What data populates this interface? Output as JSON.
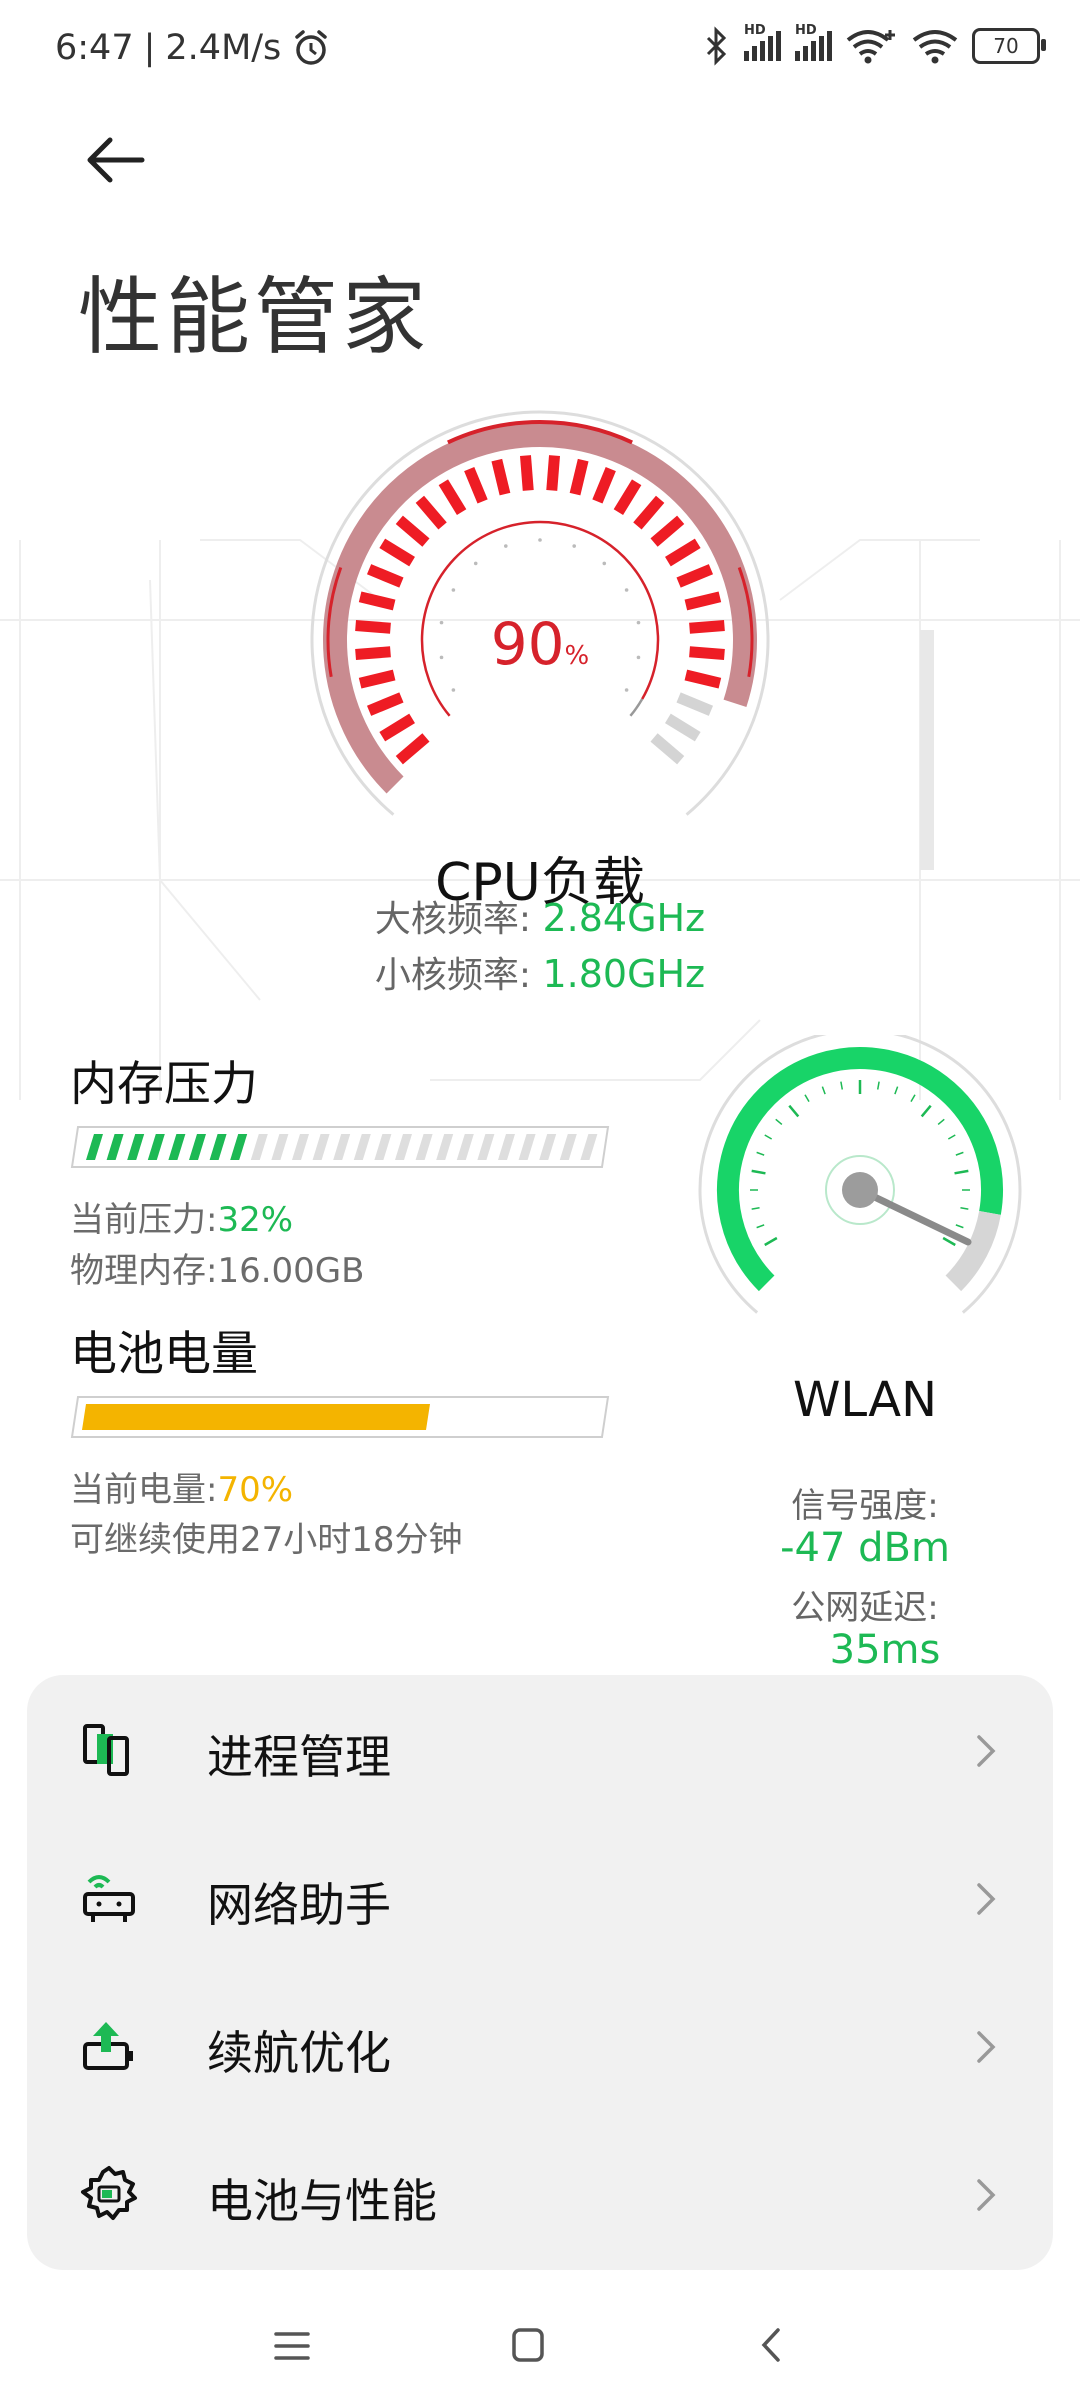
{
  "status_bar": {
    "time": "6:47",
    "separator": "|",
    "net_speed": "2.4M/s",
    "battery_level": "70",
    "hd_label": "HD",
    "icons": [
      "alarm-icon",
      "bluetooth-icon",
      "hd-signal-icon",
      "hd-signal-icon",
      "wifi-plus-icon",
      "wifi-icon",
      "battery-icon"
    ]
  },
  "header": {
    "back_icon": "back-arrow-icon",
    "title": "性能管家"
  },
  "cpu": {
    "load_value": "90",
    "load_unit": "%",
    "load_fraction": 0.9,
    "title": "CPU负载",
    "big_core_label": "大核频率:",
    "big_core_value": "2.84GHz",
    "small_core_label": "小核频率:",
    "small_core_value": "1.80GHz"
  },
  "memory": {
    "title": "内存压力",
    "pressure_label": "当前压力:",
    "pressure_value": "32%",
    "pressure_fraction": 0.32,
    "physical_label": "物理内存:",
    "physical_value": "16.00GB"
  },
  "battery": {
    "title": "电池电量",
    "level_label": "当前电量:",
    "level_value": "70%",
    "level_fraction": 0.7,
    "remaining_text": "可继续使用27小时18分钟"
  },
  "wlan": {
    "title": "WLAN",
    "signal_label": "信号强度:",
    "signal_value": "-47 dBm",
    "latency_label": "公网延迟:",
    "latency_value": "35ms"
  },
  "menu": {
    "items": [
      {
        "label": "进程管理",
        "icon": "process-manage-icon"
      },
      {
        "label": "网络助手",
        "icon": "network-router-icon"
      },
      {
        "label": "续航优化",
        "icon": "battery-boost-icon"
      },
      {
        "label": "电池与性能",
        "icon": "gear-battery-icon"
      }
    ]
  },
  "nav_bar": {
    "buttons": [
      "menu-icon",
      "home-square-icon",
      "back-chevron-icon"
    ]
  },
  "colors": {
    "accent_green": "#1db954",
    "cpu_red": "#e0141e",
    "battery_yellow": "#f4b400",
    "card_bg": "#f1f1f1"
  }
}
